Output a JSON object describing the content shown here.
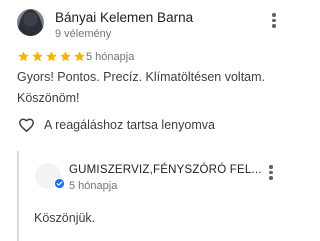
{
  "review": {
    "author_name": "Bányai Kelemen Barna",
    "author_review_count": "9 vélemény",
    "rating": 5,
    "max_rating": 5,
    "date": "5 hónapja",
    "text": "Gyors! Pontos. Precíz. Klímatöltésen voltam. Köszönöm!",
    "like_label": "A reagáláshoz tartsa lenyomva",
    "icons": {
      "more": "more-vert-icon",
      "like": "heart-outline-icon",
      "star": "star-icon"
    },
    "colors": {
      "star": "#F4B400",
      "secondary_text": "#70757A"
    }
  },
  "owner_reply": {
    "name": "GUMISZERVIZ,FÉNYSZÓRÓ FEL...",
    "date": "5 hónapja",
    "text": "Köszönjük.",
    "icons": {
      "verified": "verified-check-icon",
      "more": "more-vert-icon"
    },
    "colors": {
      "verified": "#1A73E8"
    }
  }
}
